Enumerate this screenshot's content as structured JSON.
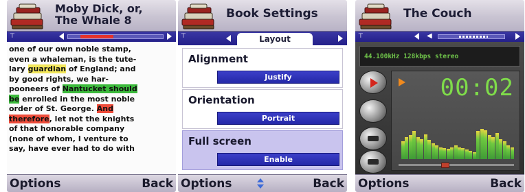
{
  "reader_screen": {
    "title": "Moby Dick, or,\nThe Whale 8",
    "reading_progress": 0.4,
    "lines": [
      [
        {
          "t": "one of our own noble stamp,",
          "h": ""
        }
      ],
      [
        {
          "t": "even a whaleman, is the tute-",
          "h": ""
        }
      ],
      [
        {
          "t": "lary ",
          "h": ""
        },
        {
          "t": "guardian",
          "h": "yellow"
        },
        {
          "t": " of England; and",
          "h": ""
        }
      ],
      [
        {
          "t": "by good rights, we har-",
          "h": ""
        }
      ],
      [
        {
          "t": "pooneers of ",
          "h": ""
        },
        {
          "t": "Nantucket should",
          "h": "green"
        }
      ],
      [
        {
          "t": "be",
          "h": "green"
        },
        {
          "t": " enrolled in the most noble",
          "h": ""
        }
      ],
      [
        {
          "t": "order of St. George. ",
          "h": ""
        },
        {
          "t": "And",
          "h": "red"
        }
      ],
      [
        {
          "t": "therefore",
          "h": "red"
        },
        {
          "t": ", let not the knights",
          "h": ""
        }
      ],
      [
        {
          "t": "of that honorable company",
          "h": ""
        }
      ],
      [
        {
          "t": "(none of whom, I venture to",
          "h": ""
        }
      ],
      [
        {
          "t": "say, have ever had to do with",
          "h": ""
        }
      ]
    ],
    "softkeys": {
      "left": "Options",
      "right": "Back"
    }
  },
  "settings_screen": {
    "title": "Book Settings",
    "tab": "Layout",
    "settings": [
      {
        "label": "Alignment",
        "value": "Justify",
        "selected": false
      },
      {
        "label": "Orientation",
        "value": "Portrait",
        "selected": false
      },
      {
        "label": "Full screen",
        "value": "Enable",
        "selected": true
      }
    ],
    "softkeys": {
      "left": "Options",
      "right": "Back"
    }
  },
  "player_screen": {
    "title": "The Couch",
    "volume_level": 0.55,
    "stream_info": "44.100kHz 128kbps stereo",
    "timer": "00:02",
    "seek_position": 0.4,
    "eq_levels": [
      0.45,
      0.55,
      0.6,
      0.7,
      0.55,
      0.5,
      0.62,
      0.48,
      0.4,
      0.35,
      0.3,
      0.28,
      0.25,
      0.3,
      0.35,
      0.3,
      0.28,
      0.24,
      0.2,
      0.18,
      0.7,
      0.75,
      0.72,
      0.6,
      0.55,
      0.65,
      0.5,
      0.45,
      0.35,
      0.3
    ],
    "softkeys": {
      "left": "Options",
      "right": "Back"
    }
  },
  "colors": {
    "title_bg": "#c9c4d2",
    "nav_blue": "#2b279a",
    "highlight_yellow": "#f3e75b",
    "highlight_green": "#3cba3c",
    "highlight_red": "#ee4c3a",
    "lcd_green": "#7fdc4a"
  }
}
